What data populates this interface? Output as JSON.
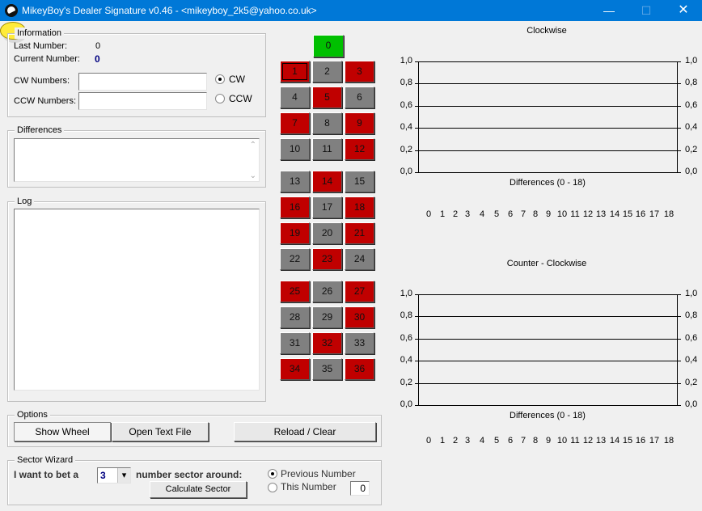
{
  "window": {
    "title": "MikeyBoy's Dealer Signature v0.46 - <mikeyboy_2k5@yahoo.co.uk>",
    "min_glyph": "—",
    "max_glyph": "☐",
    "close_glyph": "✕"
  },
  "information": {
    "legend": "Information",
    "last_label": "Last Number:",
    "last_value": "0",
    "current_label": "Current Number:",
    "current_value": "0",
    "cw_label": "CW Numbers:",
    "ccw_label": "CCW Numbers:",
    "cw_value": "",
    "ccw_value": "",
    "radio_cw": "CW",
    "radio_ccw": "CCW",
    "selected": "CW"
  },
  "differences": {
    "legend": "Differences",
    "up": "⌃",
    "down": "⌄"
  },
  "log": {
    "legend": "Log"
  },
  "options": {
    "legend": "Options",
    "show_wheel": "Show Wheel",
    "open_text_file": "Open Text File",
    "reload_clear": "Reload / Clear"
  },
  "sector_wizard": {
    "legend": "Sector Wizard",
    "prefix": "I want to bet a",
    "count": "3",
    "suffix": "number sector around:",
    "calculate": "Calculate Sector",
    "radio_previous": "Previous Number",
    "radio_this": "This Number",
    "this_value": "0",
    "dropdown_glyph": "▾"
  },
  "numbers": {
    "zero": "0",
    "grid": [
      {
        "n": "1",
        "color": "red",
        "selected": true
      },
      {
        "n": "2",
        "color": "grey"
      },
      {
        "n": "3",
        "color": "red"
      },
      {
        "n": "4",
        "color": "grey"
      },
      {
        "n": "5",
        "color": "red"
      },
      {
        "n": "6",
        "color": "grey"
      },
      {
        "n": "7",
        "color": "red"
      },
      {
        "n": "8",
        "color": "grey"
      },
      {
        "n": "9",
        "color": "red"
      },
      {
        "n": "10",
        "color": "grey"
      },
      {
        "n": "11",
        "color": "grey"
      },
      {
        "n": "12",
        "color": "red"
      },
      {
        "n": "13",
        "color": "grey"
      },
      {
        "n": "14",
        "color": "red"
      },
      {
        "n": "15",
        "color": "grey"
      },
      {
        "n": "16",
        "color": "red"
      },
      {
        "n": "17",
        "color": "grey"
      },
      {
        "n": "18",
        "color": "red"
      },
      {
        "n": "19",
        "color": "red"
      },
      {
        "n": "20",
        "color": "grey"
      },
      {
        "n": "21",
        "color": "red"
      },
      {
        "n": "22",
        "color": "grey"
      },
      {
        "n": "23",
        "color": "red"
      },
      {
        "n": "24",
        "color": "grey"
      },
      {
        "n": "25",
        "color": "red"
      },
      {
        "n": "26",
        "color": "grey"
      },
      {
        "n": "27",
        "color": "red"
      },
      {
        "n": "28",
        "color": "grey"
      },
      {
        "n": "29",
        "color": "grey"
      },
      {
        "n": "30",
        "color": "red"
      },
      {
        "n": "31",
        "color": "grey"
      },
      {
        "n": "32",
        "color": "red"
      },
      {
        "n": "33",
        "color": "grey"
      },
      {
        "n": "34",
        "color": "red"
      },
      {
        "n": "35",
        "color": "grey"
      },
      {
        "n": "36",
        "color": "red"
      }
    ]
  },
  "colors": {
    "red": "#c00000",
    "grey": "#808080",
    "green": "#00c000",
    "titlebar": "#0078d7"
  },
  "chart_data": [
    {
      "type": "bar",
      "title": "Clockwise",
      "xlabel": "Differences (0 - 18)",
      "ylabel": "",
      "ylim": [
        0,
        1
      ],
      "yticks": [
        "1,0",
        "0,8",
        "0,6",
        "0,4",
        "0,2",
        "0,0"
      ],
      "categories": [
        "0",
        "1",
        "2",
        "3",
        "4",
        "5",
        "6",
        "7",
        "8",
        "9",
        "10",
        "11",
        "12",
        "13",
        "14",
        "15",
        "16",
        "17",
        "18"
      ],
      "values": [
        0,
        0,
        0,
        0,
        0,
        0,
        0,
        0,
        0,
        0,
        0,
        0,
        0,
        0,
        0,
        0,
        0,
        0,
        0
      ]
    },
    {
      "type": "bar",
      "title": "Counter - Clockwise",
      "xlabel": "Differences (0 - 18)",
      "ylabel": "",
      "ylim": [
        0,
        1
      ],
      "yticks": [
        "1,0",
        "0,8",
        "0,6",
        "0,4",
        "0,2",
        "0,0"
      ],
      "categories": [
        "0",
        "1",
        "2",
        "3",
        "4",
        "5",
        "6",
        "7",
        "8",
        "9",
        "10",
        "11",
        "12",
        "13",
        "14",
        "15",
        "16",
        "17",
        "18"
      ],
      "values": [
        0,
        0,
        0,
        0,
        0,
        0,
        0,
        0,
        0,
        0,
        0,
        0,
        0,
        0,
        0,
        0,
        0,
        0,
        0
      ]
    }
  ]
}
